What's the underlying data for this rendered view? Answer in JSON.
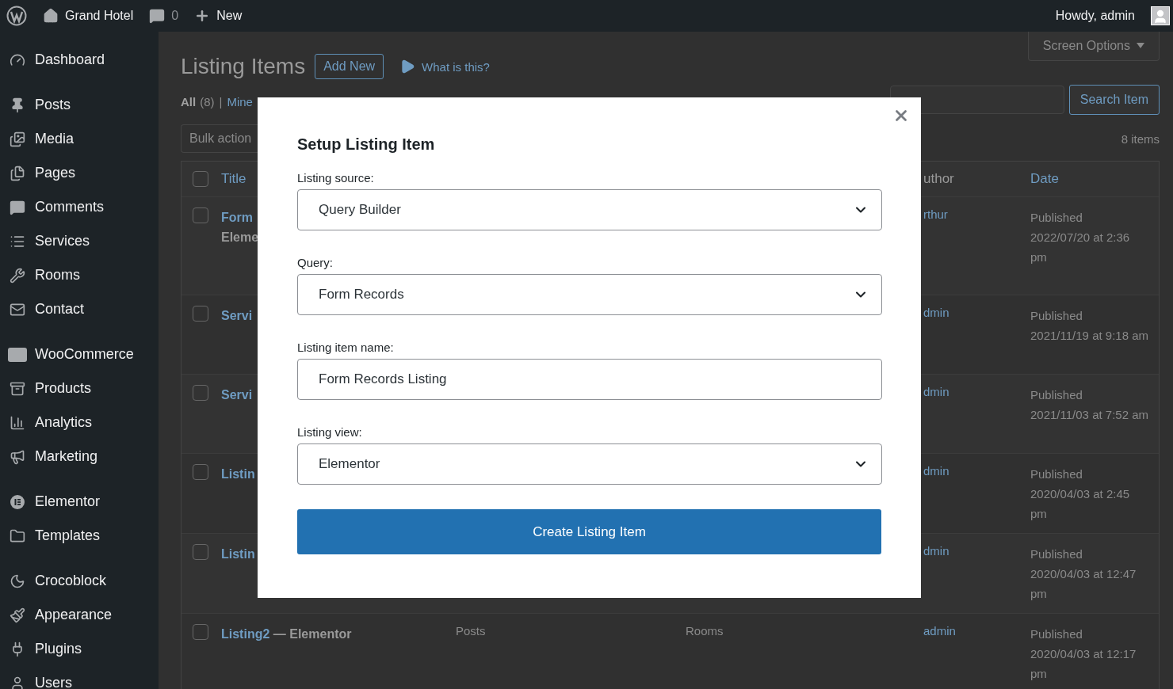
{
  "admin_bar": {
    "site": "Grand Hotel",
    "comments": "0",
    "new": "New",
    "greeting": "Howdy, admin"
  },
  "sidebar": {
    "groups": [
      [
        {
          "label": "Dashboard"
        }
      ],
      [
        {
          "label": "Posts"
        },
        {
          "label": "Media"
        },
        {
          "label": "Pages"
        },
        {
          "label": "Comments"
        },
        {
          "label": "Services"
        },
        {
          "label": "Rooms"
        },
        {
          "label": "Contact"
        }
      ],
      [
        {
          "label": "WooCommerce"
        },
        {
          "label": "Products"
        },
        {
          "label": "Analytics"
        },
        {
          "label": "Marketing"
        }
      ],
      [
        {
          "label": "Elementor"
        },
        {
          "label": "Templates"
        }
      ],
      [
        {
          "label": "Crocoblock"
        },
        {
          "label": "Appearance"
        },
        {
          "label": "Plugins"
        },
        {
          "label": "Users"
        }
      ]
    ]
  },
  "page": {
    "title": "Listing Items",
    "add_new": "Add New",
    "help_link": "What is this?",
    "screen_options": "Screen Options",
    "separator": "|",
    "views": [
      {
        "label": "All",
        "count": "(8)",
        "selected": true
      },
      {
        "label": "Mine",
        "selected": false
      }
    ],
    "bulk_actions": "Bulk action",
    "search_button": "Search Item",
    "item_count": "8 items"
  },
  "table": {
    "header_checked": false,
    "columns": {
      "title": "Title",
      "author": "uthor",
      "date": "Date"
    },
    "rows": [
      {
        "checked": false,
        "title_lines": [
          "Form",
          "Eleme"
        ],
        "author": "rthur",
        "status": "Published",
        "date": "2022/07/20 at 2:36 pm"
      },
      {
        "checked": false,
        "title_lines": [
          "Servi"
        ],
        "author": "dmin",
        "status": "Published",
        "date": "2021/11/19 at 9:18 am"
      },
      {
        "checked": false,
        "title_lines": [
          "Servi"
        ],
        "author": "dmin",
        "status": "Published",
        "date": "2021/11/03 at 7:52 am"
      },
      {
        "checked": false,
        "title_lines": [
          "Listin"
        ],
        "author": "dmin",
        "status": "Published",
        "date": "2020/04/03 at 2:45 pm"
      },
      {
        "checked": false,
        "title_lines": [
          "Listin"
        ],
        "author": "dmin",
        "status": "Published",
        "date": "2020/04/03 at 12:47 pm"
      },
      {
        "checked": false,
        "title_lines": [
          "Listing2"
        ],
        "suffix": "— Elementor",
        "column_3": "Posts",
        "column_4": "Rooms",
        "author": "admin",
        "status": "Published",
        "date": "2020/04/03 at 12:17 pm"
      }
    ]
  },
  "modal": {
    "title": "Setup Listing Item",
    "fields": [
      {
        "kind": "select",
        "label": "Listing source:",
        "value": "Query Builder"
      },
      {
        "kind": "select",
        "label": "Query:",
        "value": "Form Records"
      },
      {
        "kind": "text",
        "label": "Listing item name:",
        "value": "Form Records Listing"
      },
      {
        "kind": "select",
        "label": "Listing view:",
        "value": "Elementor"
      }
    ],
    "button": "Create Listing Item"
  }
}
